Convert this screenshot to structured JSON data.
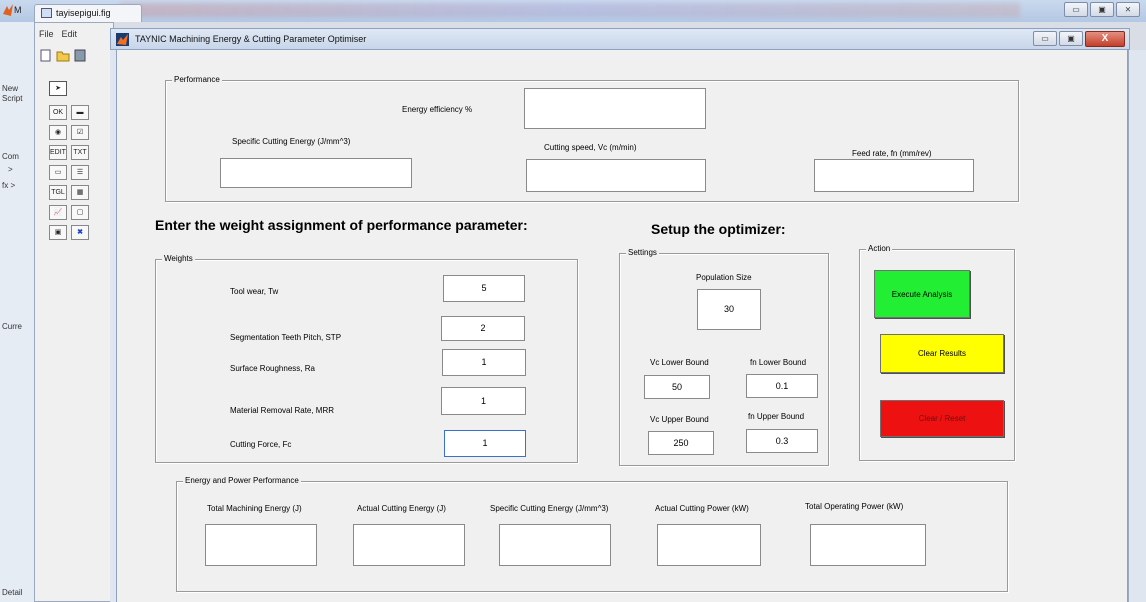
{
  "background": {
    "matlab_label": "M",
    "left_panel_texts": [
      "New",
      "Script",
      "Com",
      ">",
      "fx >",
      "Curre",
      "Detail"
    ],
    "window_buttons": [
      "▭",
      "▣",
      "⨯"
    ]
  },
  "guide": {
    "tab_title": "tayisepigui.fig",
    "menu": [
      "File",
      "Edit"
    ],
    "palette": [
      {
        "icon": "pointer-icon",
        "text": "➤"
      },
      {
        "icon": "pushbutton-icon",
        "text": "OK"
      },
      {
        "icon": "slider-icon",
        "text": "▬"
      },
      {
        "icon": "radiobutton-icon",
        "text": "◉"
      },
      {
        "icon": "checkbox-icon",
        "text": "☑"
      },
      {
        "icon": "edit-text-icon",
        "text": "EDIT"
      },
      {
        "icon": "static-text-icon",
        "text": "TXT"
      },
      {
        "icon": "popup-menu-icon",
        "text": "▭"
      },
      {
        "icon": "listbox-icon",
        "text": "☰"
      },
      {
        "icon": "toggle-button-icon",
        "text": "TGL"
      },
      {
        "icon": "table-icon",
        "text": "▦"
      },
      {
        "icon": "axes-icon",
        "text": "📈"
      },
      {
        "icon": "panel-icon",
        "text": "▢"
      },
      {
        "icon": "button-group-icon",
        "text": "▣"
      },
      {
        "icon": "activex-icon",
        "text": "✖"
      }
    ]
  },
  "window": {
    "title": "TAYNIC Machining Energy & Cutting Parameter Optimiser",
    "close_label": "X"
  },
  "performance": {
    "panel_title": "Performance",
    "energy_efficiency_label": "Energy efficiency   %",
    "energy_efficiency_value": "",
    "specific_cutting_energy_label": "Specific Cutting Energy (J/mm^3)",
    "specific_cutting_energy_value": "",
    "cutting_speed_label": "Cutting speed, Vc    (m/min)",
    "cutting_speed_value": "",
    "feed_rate_label": "Feed rate, fn    (mm/rev)",
    "feed_rate_value": ""
  },
  "weights_heading": "Enter the weight assignment of performance parameter:",
  "optimizer_heading": "Setup the optimizer:",
  "weights": {
    "panel_title": "Weights",
    "items": [
      {
        "label": "Tool wear,  Tw",
        "value": "5"
      },
      {
        "label": "Segmentation Teeth Pitch,  STP",
        "value": "2"
      },
      {
        "label": "Surface Roughness,  Ra",
        "value": "1"
      },
      {
        "label": "Material Removal Rate, MRR",
        "value": "1"
      },
      {
        "label": "Cutting Force,  Fc",
        "value": "1"
      }
    ]
  },
  "settings": {
    "panel_title": "Settings",
    "population_label": "Population Size",
    "population_value": "30",
    "vc_lower_label": "Vc Lower Bound",
    "vc_lower_value": "50",
    "fn_lower_label": "fn Lower Bound",
    "fn_lower_value": "0.1",
    "vc_upper_label": "Vc Upper Bound",
    "vc_upper_value": "250",
    "fn_upper_label": "fn Upper Bound",
    "fn_upper_value": "0.3"
  },
  "action": {
    "panel_title": "Action",
    "execute_label": "Execute Analysis",
    "clear_results_label": "Clear Results",
    "reset_label": "Clear / Reset",
    "colors": {
      "execute": "#22ee33",
      "clear_results": "#ffff00",
      "reset": "#ee1111"
    }
  },
  "energy": {
    "panel_title": "Energy and Power Performance",
    "items": [
      {
        "label": "Total Machining Energy  (J)",
        "value": ""
      },
      {
        "label": "Actual Cutting Energy  (J)",
        "value": ""
      },
      {
        "label": "Specific Cutting Energy  (J/mm^3)",
        "value": ""
      },
      {
        "label": "Actual Cutting Power  (kW)",
        "value": ""
      },
      {
        "label": "Total Operating Power  (kW)",
        "value": ""
      }
    ]
  }
}
